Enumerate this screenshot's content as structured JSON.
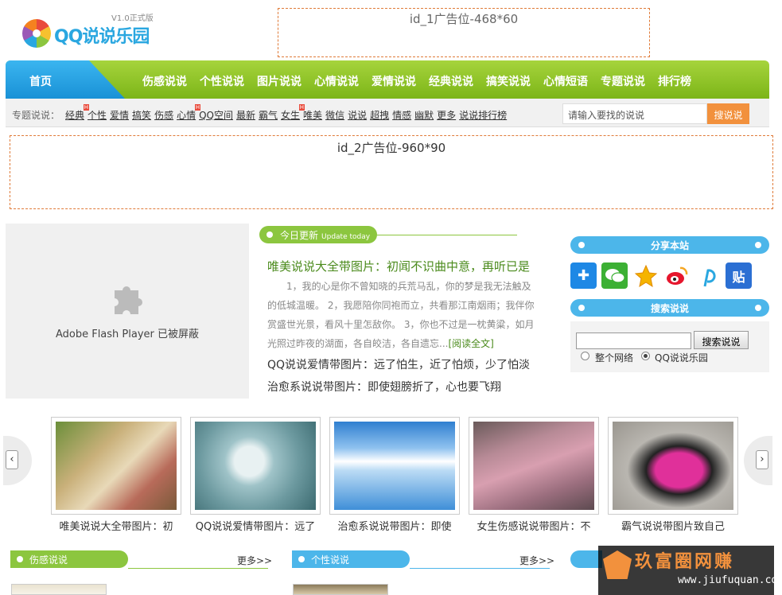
{
  "logo": {
    "text": "QQ说说乐园",
    "version": "V1.0正式版"
  },
  "ads": {
    "ad1": "id_1广告位-468*60",
    "ad2": "id_2广告位-960*90"
  },
  "nav": {
    "home": "首页",
    "items": [
      "伤感说说",
      "个性说说",
      "图片说说",
      "心情说说",
      "爱情说说",
      "经典说说",
      "搞笑说说",
      "心情短语",
      "专题说说",
      "排行榜"
    ]
  },
  "subnav": {
    "label": "专题说说：",
    "items": [
      "经典",
      "个性",
      "爱情",
      "搞笑",
      "伤感",
      "心情",
      "QQ空间",
      "最新",
      "霸气",
      "女生",
      "唯美",
      "微信",
      "说说",
      "超拽",
      "情感",
      "幽默",
      "更多",
      "说说排行榜"
    ],
    "hot": [
      0,
      5,
      9
    ]
  },
  "top_search": {
    "placeholder": "请输入要找的说说",
    "button": "搜说说"
  },
  "flash": {
    "text": "Adobe Flash Player 已被屏蔽"
  },
  "today": {
    "label": "今日更新",
    "sub": "Update today",
    "title": "唯美说说大全带图片：初闻不识曲中意，再听已是",
    "body": "1，我的心是你不曾知晓的兵荒马乱，你的梦是我无法触及的低城温暖。 2，我愿陪你同袍而立，共看那江南烟雨；我伴你赏盛世光景，看风十里怎敌你。 3，你也不过是一枕黄粱，如月光照过昨夜的湖面，各自皎洁，各自遗忘...",
    "more": "[阅读全文]",
    "links": [
      "QQ说说爱情带图片：远了怕生，近了怕烦，少了怕淡",
      "治愈系说说带图片：即使翅膀折了，心也要飞翔"
    ]
  },
  "share": {
    "title": "分享本站",
    "icons": [
      "plus-icon",
      "wechat-icon",
      "qzone-star-icon",
      "weibo-icon",
      "pinterest-p-icon",
      "tieba-icon"
    ]
  },
  "site_search": {
    "title": "搜索说说",
    "button": "搜索说说",
    "options": [
      "整个网络",
      "QQ说说乐园"
    ],
    "selected": 1
  },
  "carousel": {
    "items": [
      "唯美说说大全带图片：初",
      "QQ说说爱情带图片：远了",
      "治愈系说说带图片：即使",
      "女生伤感说说带图片：不",
      "霸气说说带图片致自己"
    ]
  },
  "sections": {
    "items": [
      {
        "title": "伤感说说",
        "more": "更多>>",
        "color": "#8cc63f"
      },
      {
        "title": "个性说说",
        "more": "更多>>",
        "color": "#4cb6ea"
      }
    ]
  },
  "watermark": {
    "title": "玖富圈网赚",
    "url": "www.jiufuquan.com"
  },
  "colors": {
    "nav_green": "#8cc63f",
    "nav_blue": "#2aa7e0",
    "accent_orange": "#f2913d"
  }
}
